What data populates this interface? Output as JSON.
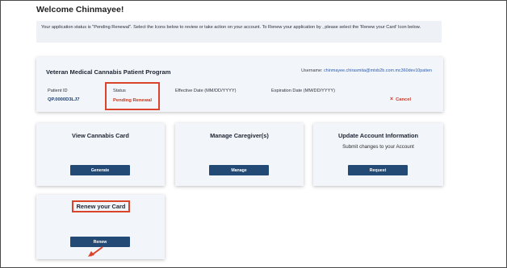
{
  "page": {
    "welcome": "Welcome Chinmayee!",
    "notice": "Your application status is \"Pending Renewal\". Select the Icons below to review or take action on your account. To Renew your application by , please select the 'Renew your Card' Icon below."
  },
  "program": {
    "title": "Veteran Medical Cannabis Patient Program",
    "username_label": "Username:",
    "username_value": "chinmayee.chirasmita@mtxb2b.com.mc360dev10patien",
    "patient_id_label": "Patient ID",
    "patient_id_value": "QP.0000D3LJ7",
    "status_label": "Status",
    "status_value": "Pending Renewal",
    "effective_label": "Effective Date (MM/DD/YYYY)",
    "expiration_label": "Expiration Date (MM/DD/YYYY)",
    "cancel_icon": "×",
    "cancel_label": "Cancel"
  },
  "cards": {
    "view_card": {
      "title": "View Cannabis Card",
      "button": "Generate"
    },
    "caregiver": {
      "title": "Manage Caregiver(s)",
      "button": "Manage"
    },
    "update": {
      "title": "Update Account Information",
      "subtitle": "Submit changes to your Account",
      "button": "Request"
    },
    "renew": {
      "title": "Renew your Card",
      "button": "Renew"
    }
  },
  "icons": {
    "cancel": "close-icon",
    "arrow": "pointer-arrow-icon"
  },
  "colors": {
    "primary_button": "#234a74",
    "highlight": "#d9442b",
    "card_bg": "#f2f5f9"
  }
}
